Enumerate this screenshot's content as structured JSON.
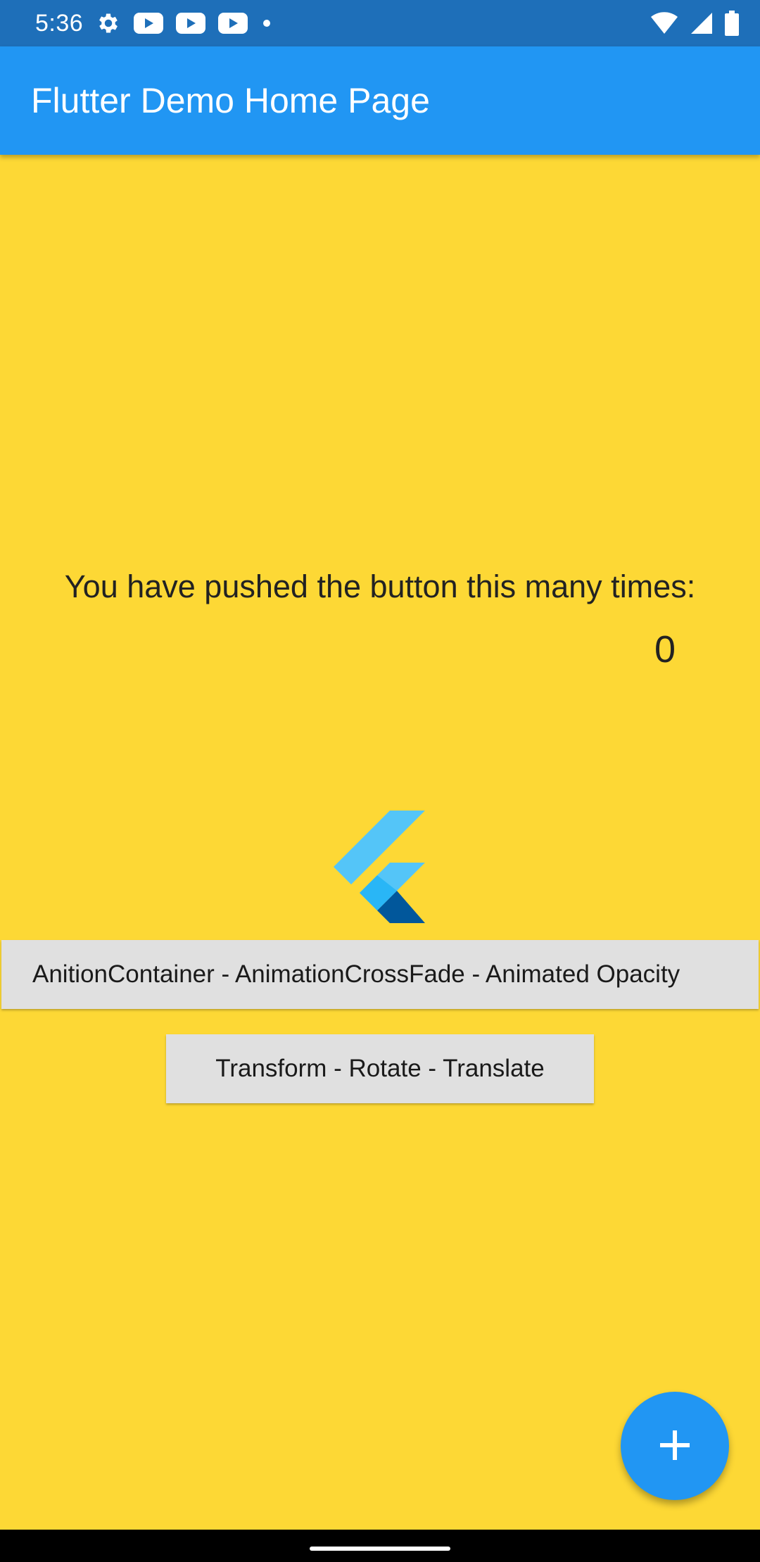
{
  "status_bar": {
    "time": "5:36",
    "left_icons": [
      "gear-icon",
      "youtube-icon",
      "youtube-icon",
      "youtube-icon",
      "dot-icon"
    ],
    "right_icons": [
      "wifi-icon",
      "signal-icon",
      "battery-icon"
    ]
  },
  "app_bar": {
    "title": "Flutter Demo Home Page",
    "color": "#2196F3"
  },
  "main": {
    "background": "#FDD835",
    "counter_label": "You have pushed the button this many times:",
    "counter_value": "0",
    "logo_icon": "flutter-logo-icon",
    "buttons": [
      {
        "label": "AnitionContainer - AnimationCrossFade - Animated Opacity"
      },
      {
        "label": "Transform - Rotate - Translate"
      }
    ]
  },
  "fab": {
    "icon": "plus-icon",
    "color": "#2196F3"
  },
  "nav_bar": {
    "handle": "home-handle"
  }
}
